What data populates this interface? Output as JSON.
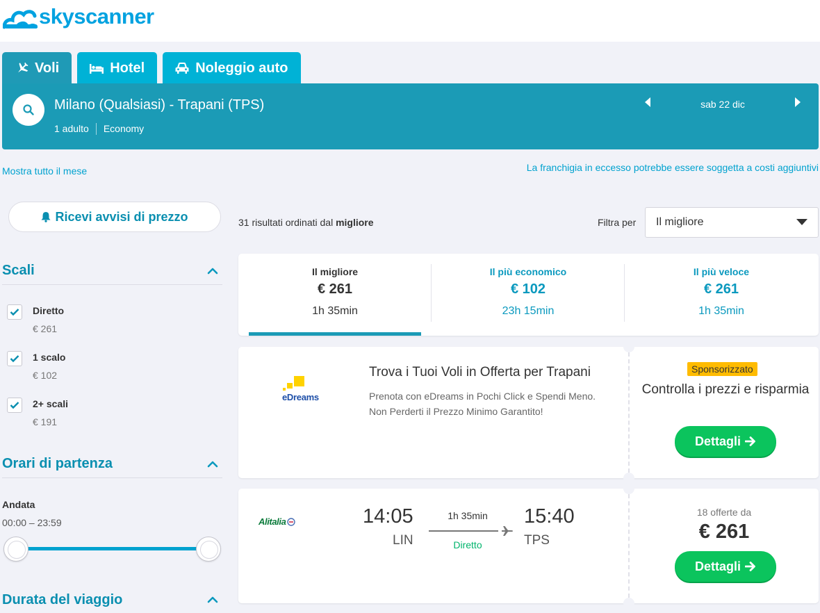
{
  "brand": {
    "name": "skyscanner"
  },
  "tabs": [
    {
      "label": "Voli",
      "icon": "plane-icon",
      "active": true
    },
    {
      "label": "Hotel",
      "icon": "bed-icon",
      "active": false
    },
    {
      "label": "Noleggio auto",
      "icon": "car-icon",
      "active": false
    }
  ],
  "search": {
    "route": "Milano (Qualsiasi) - Trapani (TPS)",
    "passengers": "1 adulto",
    "cabin": "Economy",
    "date": "sab 22 dic"
  },
  "links": {
    "whole_month": "Mostra tutto il mese",
    "baggage_notice": "La franchigia in eccesso potrebbe essere soggetta a costi aggiuntivi"
  },
  "price_alert": {
    "label": "Ricevi avvisi di prezzo"
  },
  "filters": {
    "stops": {
      "title": "Scali",
      "options": [
        {
          "label": "Diretto",
          "price": "€ 261",
          "checked": true
        },
        {
          "label": "1 scalo",
          "price": "€ 102",
          "checked": true
        },
        {
          "label": "2+ scali",
          "price": "€ 191",
          "checked": true
        }
      ]
    },
    "departure_times": {
      "title": "Orari di partenza",
      "leg_label": "Andata",
      "range": "00:00 – 23:59"
    },
    "duration": {
      "title": "Durata del viaggio"
    }
  },
  "results": {
    "count_text": "31 risultati ordinati dal ",
    "sort_bold": "migliore",
    "filter_label": "Filtra per",
    "filter_value": "Il migliore"
  },
  "sort_tabs": [
    {
      "label": "Il migliore",
      "price": "€ 261",
      "duration": "1h 35min",
      "active": true
    },
    {
      "label": "Il più economico",
      "price": "€ 102",
      "duration": "23h 15min",
      "active": false
    },
    {
      "label": "Il più veloce",
      "price": "€ 261",
      "duration": "1h 35min",
      "active": false
    }
  ],
  "ad": {
    "logo_text": "eDreams",
    "title": "Trova i Tuoi Voli in Offerta per Trapani",
    "body": "Prenota con eDreams in Pochi Click e Spendi Meno. Non Perderti il Prezzo Minimo Garantito!",
    "badge": "Sponsorizzato",
    "cta_text": "Controlla i prezzi e risparmia",
    "button": "Dettagli"
  },
  "flight": {
    "airline_logo_text": "Alitalia",
    "dep_time": "14:05",
    "dep_airport": "LIN",
    "duration": "1h 35min",
    "stops": "Direct",
    "stops_label": "Diretto",
    "arr_time": "15:40",
    "arr_airport": "TPS",
    "offers": "18 offerte da",
    "price": "€ 261",
    "button": "Dettagli"
  },
  "colors": {
    "brand": "#00a2e0",
    "tab": "#00b2d6",
    "searchbar": "#1b9bb6",
    "accent_link": "#0a99be",
    "cta_green": "#0bc45d",
    "sponsored": "#ffbb00",
    "page_bg": "#f1f2f8"
  }
}
